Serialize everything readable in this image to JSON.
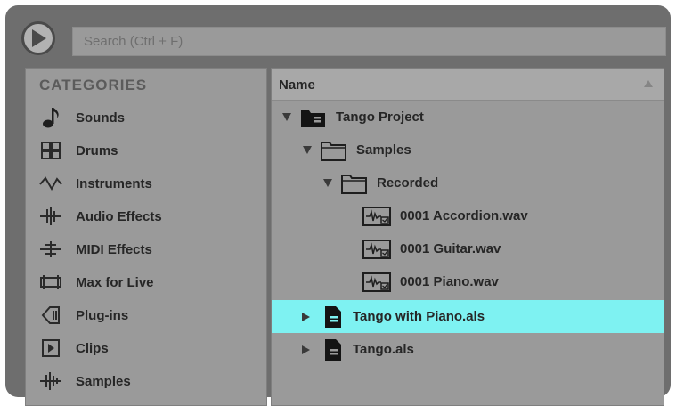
{
  "search": {
    "placeholder": "Search (Ctrl + F)"
  },
  "sidebar": {
    "heading": "CATEGORIES",
    "items": [
      {
        "label": "Sounds",
        "icon": "note-icon"
      },
      {
        "label": "Drums",
        "icon": "drum-grid-icon"
      },
      {
        "label": "Instruments",
        "icon": "waveform-icon"
      },
      {
        "label": "Audio Effects",
        "icon": "audio-effects-icon"
      },
      {
        "label": "MIDI Effects",
        "icon": "midi-effects-icon"
      },
      {
        "label": "Max for Live",
        "icon": "max-for-live-icon"
      },
      {
        "label": "Plug-ins",
        "icon": "plugin-icon"
      },
      {
        "label": "Clips",
        "icon": "clip-icon"
      },
      {
        "label": "Samples",
        "icon": "samples-icon"
      }
    ]
  },
  "filelist": {
    "column_name": "Name",
    "rows": [
      {
        "label": "Tango Project",
        "icon": "project-folder-icon",
        "expanded": true,
        "selected": false
      },
      {
        "label": "Samples",
        "icon": "folder-icon",
        "expanded": true,
        "selected": false
      },
      {
        "label": "Recorded",
        "icon": "folder-icon",
        "expanded": true,
        "selected": false
      },
      {
        "label": "0001 Accordion.wav",
        "icon": "audio-file-icon",
        "selected": false
      },
      {
        "label": "0001 Guitar.wav",
        "icon": "audio-file-icon",
        "selected": false
      },
      {
        "label": "0001 Piano.wav",
        "icon": "audio-file-icon",
        "selected": false
      },
      {
        "label": "Tango with Piano.als",
        "icon": "live-set-icon",
        "expanded": false,
        "selected": true
      },
      {
        "label": "Tango.als",
        "icon": "live-set-icon",
        "expanded": false,
        "selected": false
      }
    ]
  },
  "colors": {
    "selection": "#7ef2f2",
    "panel": "#9a9a9a",
    "frame": "#6e6e6e"
  }
}
